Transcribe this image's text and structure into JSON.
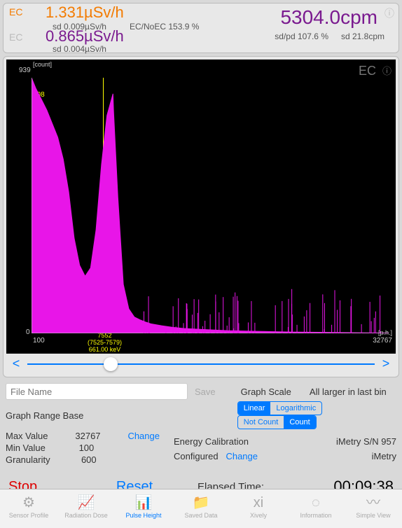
{
  "header": {
    "ec1_label": "EC",
    "ec1_value": "1.331µSv/h",
    "sd1": "sd 0.009µSv/h",
    "ec_noec": "EC/NoEC 153.9 %",
    "ec2_label": "EC",
    "ec2_value": "0.865µSv/h",
    "sd2": "sd 0.004µSv/h",
    "cpm": "5304.0cpm",
    "sdpd": "sd/pd 107.6 %",
    "sdcpm": "sd 21.8cpm"
  },
  "chart_data": {
    "type": "area",
    "xlabel": "[p.h.]",
    "ylabel": "[count]",
    "x_min": 100,
    "x_max": 32767,
    "y_min": 0,
    "y_max": 939,
    "badge": "EC",
    "marker_y": 408,
    "cursor": {
      "x": 7552,
      "range": "(7525-7579)",
      "kev": "661.00 keV"
    },
    "series": [
      {
        "name": "counts",
        "color": "#e815e8",
        "x": [
          100,
          500,
          1000,
          1500,
          2000,
          2500,
          3000,
          3500,
          4000,
          4500,
          5000,
          5500,
          6000,
          6500,
          7000,
          7552,
          7600,
          8000,
          8500,
          9000,
          9500,
          10000,
          10500,
          11000,
          12000,
          13000,
          14000,
          16000,
          18000,
          20000,
          24000,
          28000,
          32767
        ],
        "values": [
          939,
          900,
          860,
          820,
          770,
          720,
          640,
          520,
          350,
          250,
          210,
          240,
          380,
          620,
          800,
          880,
          820,
          500,
          180,
          90,
          60,
          50,
          42,
          35,
          28,
          22,
          18,
          14,
          10,
          8,
          5,
          3,
          1
        ]
      }
    ]
  },
  "controls": {
    "filename_placeholder": "File Name",
    "save": "Save",
    "graph_scale": "Graph Scale",
    "all_larger": "All larger in last bin",
    "scale": {
      "linear": "Linear",
      "log": "Logarithmic"
    },
    "countmode": {
      "notcount": "Not Count",
      "count": "Count"
    },
    "range_base_label": "Graph Range Base",
    "max_label": "Max Value",
    "max_value": "32767",
    "min_label": "Min Value",
    "min_value": "100",
    "gran_label": "Granularity",
    "gran_value": "600",
    "change": "Change",
    "ecal_label": "Energy Calibration",
    "configured": "Configured",
    "sn": "iMetry S/N 957",
    "brand": "iMetry"
  },
  "footer": {
    "stop": "Stop",
    "reset": "Reset",
    "elapsed_label": "Elapsed Time:",
    "elapsed_value": "00:09:38"
  },
  "tabs": [
    {
      "label": "Sensor Profile",
      "icon": "⚙"
    },
    {
      "label": "Radiation Dose",
      "icon": "📈"
    },
    {
      "label": "Pulse Height",
      "icon": "📊"
    },
    {
      "label": "Saved Data",
      "icon": "📁"
    },
    {
      "label": "Xively",
      "icon": "xi"
    },
    {
      "label": "Information",
      "icon": "◌"
    },
    {
      "label": "Simple View",
      "icon": "〰"
    }
  ]
}
